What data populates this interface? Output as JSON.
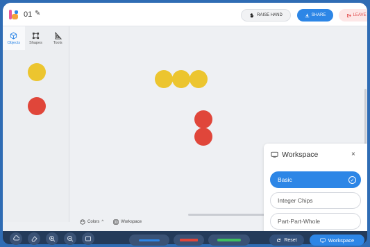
{
  "header": {
    "title": "01",
    "raise_hand_label": "RAISE HAND",
    "share_label": "SHARE",
    "leave_label": "LEAVE"
  },
  "sidebar": {
    "tabs": [
      {
        "label": "Objects",
        "icon": "cube-icon",
        "active": true
      },
      {
        "label": "Shapes",
        "icon": "square-icon",
        "active": false
      },
      {
        "label": "Tools",
        "icon": "ruler-triangle-icon",
        "active": false
      }
    ],
    "objects": [
      {
        "name": "yellow-chip",
        "color": "#ecc52f"
      },
      {
        "name": "red-chip",
        "color": "#e0463a"
      }
    ]
  },
  "canvas": {
    "tokens": [
      {
        "color": "#ecc52f"
      },
      {
        "color": "#ecc52f"
      },
      {
        "color": "#ecc52f"
      },
      {
        "color": "#e0463a"
      },
      {
        "color": "#e0463a"
      }
    ],
    "footer": {
      "colors_label": "Colors",
      "workspace_label": "Workspace"
    }
  },
  "workspace_panel": {
    "title": "Workspace",
    "options": [
      {
        "label": "Basic",
        "selected": true
      },
      {
        "label": "Integer Chips",
        "selected": false
      },
      {
        "label": "Part-Part-Whole",
        "selected": false
      }
    ]
  },
  "bottombar": {
    "reset_label": "Reset",
    "workspace_label": "Workspace",
    "pen_colors": [
      "#2d86e6",
      "#e0463a",
      "#3fbf5f"
    ]
  },
  "colors": {
    "accent": "#2d86e6",
    "yellow": "#ecc52f",
    "red": "#e0463a",
    "toolbar": "#243b5a"
  }
}
